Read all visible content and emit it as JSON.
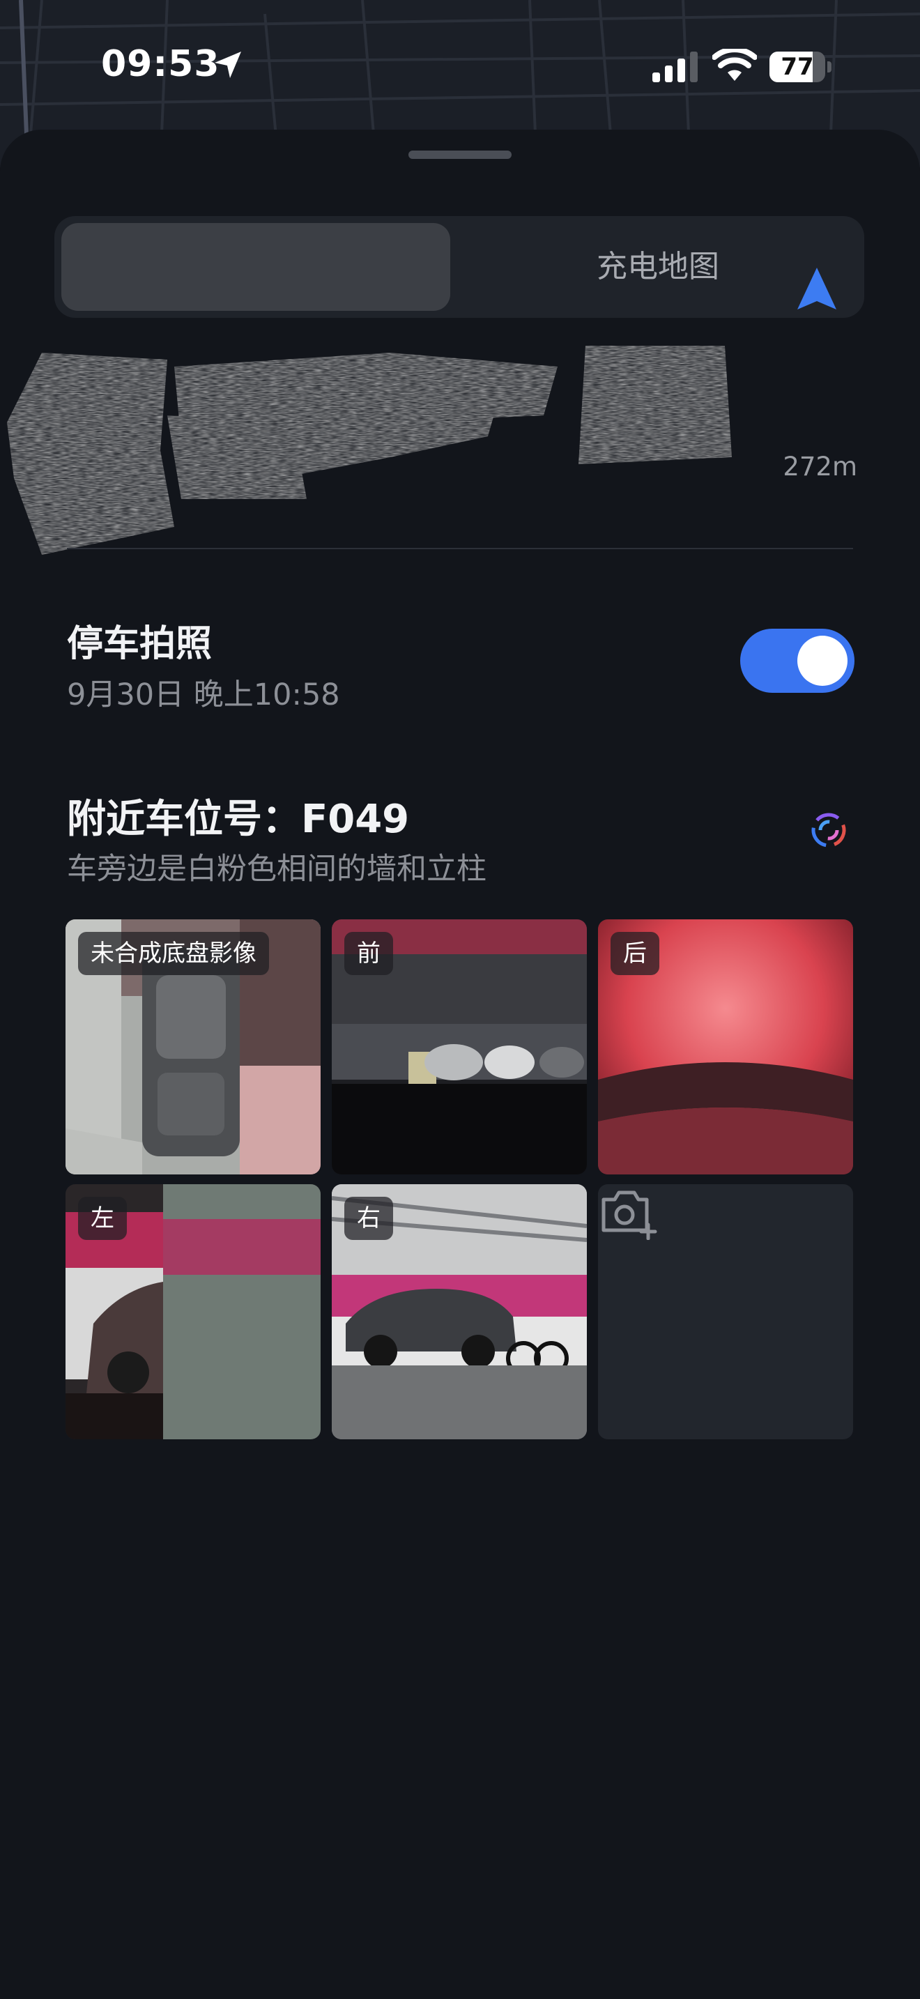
{
  "status_bar": {
    "time": "09:53",
    "battery_level": "77",
    "battery_fraction": 0.77
  },
  "segmented_control": {
    "selected_label": "",
    "other_label": "充电地图"
  },
  "destination": {
    "distance": "272m"
  },
  "parking_photo": {
    "title": "停车拍照",
    "timestamp": "9月30日 晚上10:58",
    "enabled": true
  },
  "parking_spot": {
    "title": "附近车位号：F049",
    "description": "车旁边是白粉色相间的墙和立柱"
  },
  "photos": [
    {
      "label": "未合成底盘影像",
      "icon": "photo-undercarriage"
    },
    {
      "label": "前",
      "icon": "photo-front"
    },
    {
      "label": "后",
      "icon": "photo-rear"
    },
    {
      "label": "左",
      "icon": "photo-left"
    },
    {
      "label": "右",
      "icon": "photo-right"
    }
  ],
  "colors": {
    "accent": "#3a74f0",
    "background": "#12151b",
    "secondary_text": "#8d9097"
  },
  "icons": [
    "location-arrow-icon",
    "signal-icon",
    "wifi-icon",
    "battery-icon",
    "navigation-arrow-icon",
    "ai-assistant-icon",
    "camera-plus-icon"
  ]
}
